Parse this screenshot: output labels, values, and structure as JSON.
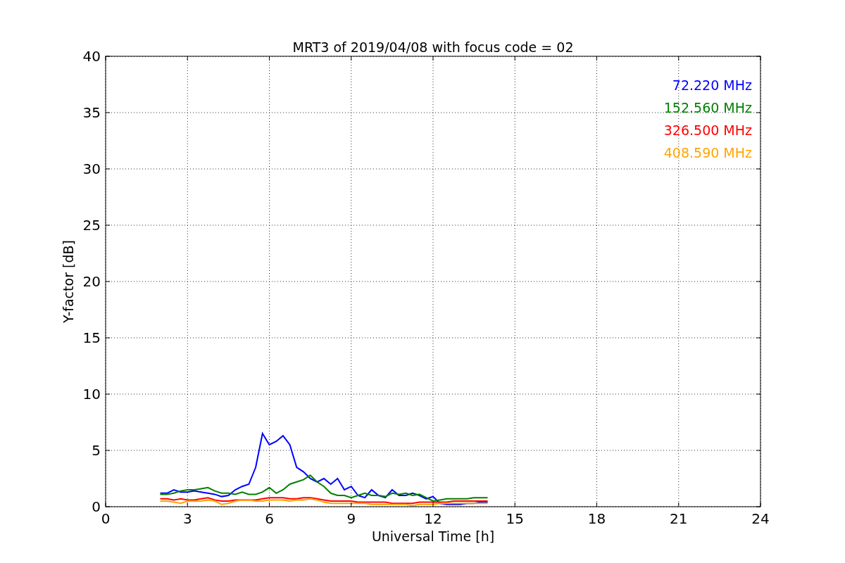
{
  "chart_data": {
    "type": "line",
    "title": "MRT3 of 2019/04/08 with focus code = 02",
    "xlabel": "Universal Time [h]",
    "ylabel": "Y-factor [dB]",
    "xlim": [
      0,
      24
    ],
    "ylim": [
      0,
      40
    ],
    "xticks": [
      0,
      3,
      6,
      9,
      12,
      15,
      18,
      21,
      24
    ],
    "yticks": [
      0,
      5,
      10,
      15,
      20,
      25,
      30,
      35,
      40
    ],
    "grid": true,
    "x": [
      2,
      2.25,
      2.5,
      2.75,
      3,
      3.25,
      3.5,
      3.75,
      4,
      4.25,
      4.5,
      4.75,
      5,
      5.25,
      5.5,
      5.75,
      6,
      6.25,
      6.5,
      6.75,
      7,
      7.25,
      7.5,
      7.75,
      8,
      8.25,
      8.5,
      8.75,
      9,
      9.25,
      9.5,
      9.75,
      10,
      10.25,
      10.5,
      10.75,
      11,
      11.25,
      11.5,
      11.75,
      12,
      12.25,
      12.5,
      12.75,
      13,
      13.25,
      13.5,
      13.75,
      14
    ],
    "series": [
      {
        "name": "72.220 MHz",
        "color": "#0000ff",
        "values": [
          1.2,
          1.2,
          1.5,
          1.3,
          1.3,
          1.4,
          1.3,
          1.2,
          1.1,
          0.9,
          1.0,
          1.5,
          1.8,
          2.0,
          3.5,
          6.5,
          5.5,
          5.8,
          6.3,
          5.5,
          3.5,
          3.1,
          2.5,
          2.2,
          2.5,
          2.0,
          2.5,
          1.5,
          1.8,
          1.0,
          0.8,
          1.5,
          1.0,
          0.8,
          1.5,
          1.0,
          1.0,
          1.2,
          1.0,
          0.7,
          0.9,
          0.3,
          0.2,
          0.2,
          0.2,
          0.3,
          0.3,
          0.4,
          0.4
        ]
      },
      {
        "name": "152.560 MHz",
        "color": "#008000",
        "values": [
          1.1,
          1.1,
          1.2,
          1.4,
          1.5,
          1.5,
          1.6,
          1.7,
          1.4,
          1.2,
          1.2,
          1.1,
          1.3,
          1.1,
          1.1,
          1.3,
          1.7,
          1.2,
          1.5,
          2.0,
          2.2,
          2.4,
          2.8,
          2.2,
          1.8,
          1.2,
          1.0,
          1.0,
          0.8,
          1.0,
          1.2,
          1.0,
          1.0,
          0.9,
          1.2,
          1.1,
          1.2,
          1.0,
          1.1,
          0.8,
          0.5,
          0.6,
          0.7,
          0.7,
          0.7,
          0.7,
          0.8,
          0.8,
          0.8
        ]
      },
      {
        "name": "326.500 MHz",
        "color": "#ff0000",
        "values": [
          0.7,
          0.7,
          0.6,
          0.7,
          0.6,
          0.6,
          0.7,
          0.8,
          0.6,
          0.5,
          0.5,
          0.6,
          0.6,
          0.6,
          0.6,
          0.7,
          0.8,
          0.8,
          0.8,
          0.7,
          0.7,
          0.8,
          0.8,
          0.7,
          0.6,
          0.5,
          0.5,
          0.5,
          0.5,
          0.4,
          0.4,
          0.4,
          0.4,
          0.4,
          0.3,
          0.3,
          0.3,
          0.3,
          0.4,
          0.4,
          0.4,
          0.4,
          0.4,
          0.5,
          0.5,
          0.5,
          0.5,
          0.5,
          0.5
        ]
      },
      {
        "name": "408.590 MHz",
        "color": "#ffa500",
        "values": [
          0.5,
          0.5,
          0.4,
          0.3,
          0.5,
          0.5,
          0.5,
          0.6,
          0.5,
          0.2,
          0.3,
          0.5,
          0.6,
          0.6,
          0.5,
          0.5,
          0.6,
          0.6,
          0.6,
          0.5,
          0.6,
          0.6,
          0.7,
          0.6,
          0.4,
          0.3,
          0.3,
          0.3,
          0.3,
          0.3,
          0.3,
          0.2,
          0.2,
          0.2,
          0.2,
          0.2,
          0.2,
          0.1,
          0.2,
          0.2,
          0.2,
          0.3,
          0.3,
          0.3,
          0.3,
          0.3,
          0.3,
          0.3,
          0.3
        ]
      }
    ]
  }
}
